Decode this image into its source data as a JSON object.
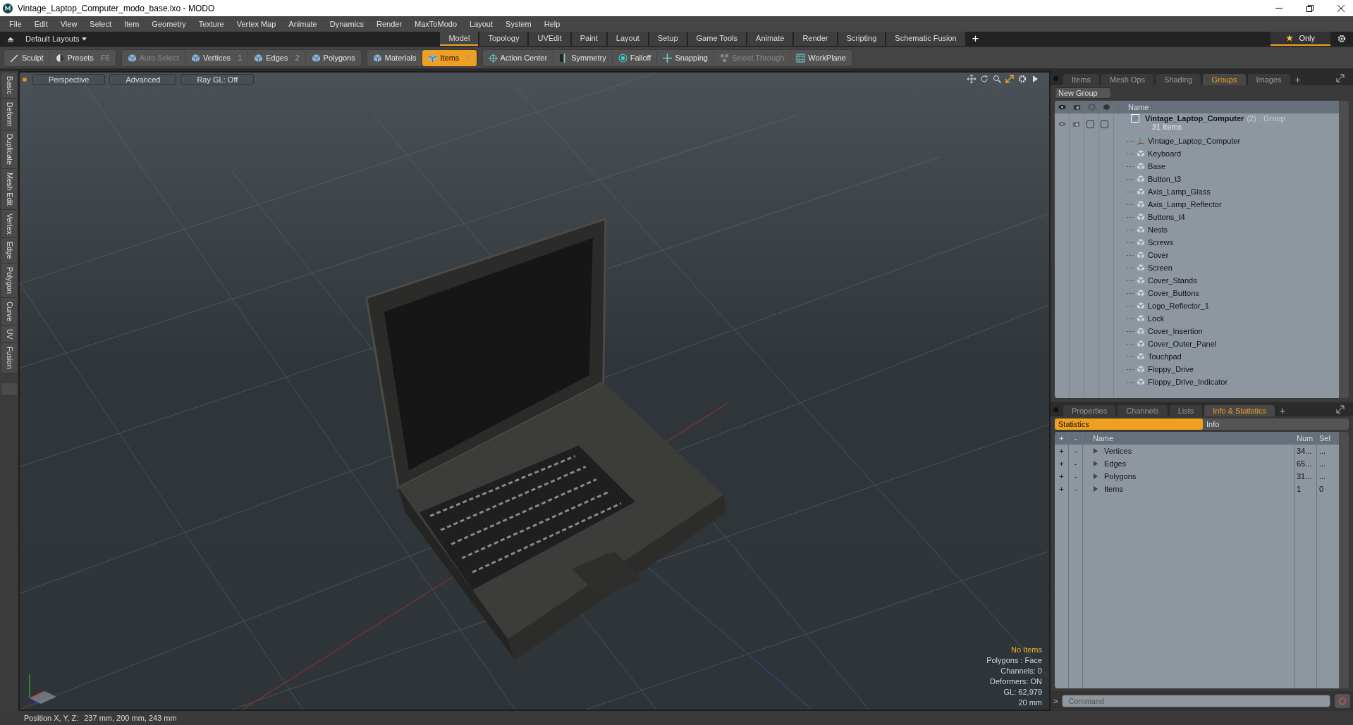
{
  "window": {
    "title": "Vintage_Laptop_Computer_modo_base.lxo - MODO"
  },
  "menu": [
    "File",
    "Edit",
    "View",
    "Select",
    "Item",
    "Geometry",
    "Texture",
    "Vertex Map",
    "Animate",
    "Dynamics",
    "Render",
    "MaxToModo",
    "Layout",
    "System",
    "Help"
  ],
  "layout_bar": {
    "layouts": "Default Layouts",
    "tabs": [
      {
        "label": "Model",
        "selected": true
      },
      {
        "label": "Topology",
        "selected": false
      },
      {
        "label": "UVEdit",
        "selected": false
      },
      {
        "label": "Paint",
        "selected": false
      },
      {
        "label": "Layout",
        "selected": false
      },
      {
        "label": "Setup",
        "selected": false
      },
      {
        "label": "Game Tools",
        "selected": false
      },
      {
        "label": "Animate",
        "selected": false
      },
      {
        "label": "Render",
        "selected": false
      },
      {
        "label": "Scripting",
        "selected": false
      },
      {
        "label": "Schematic Fusion",
        "selected": false
      }
    ],
    "add_tab": "+",
    "only": "Only"
  },
  "toolbar": [
    [
      {
        "kind": "sculpt",
        "label": "Sculpt",
        "disabled": false,
        "selected": false
      },
      {
        "kind": "presets",
        "label": "Presets",
        "shortcut": "F6",
        "disabled": false,
        "selected": false
      }
    ],
    [
      {
        "kind": "cube",
        "label": "Auto Select",
        "disabled": true,
        "selected": false
      },
      {
        "kind": "cube",
        "label": "Vertices",
        "shortcut": "1",
        "disabled": false,
        "selected": false
      },
      {
        "kind": "cube",
        "label": "Edges",
        "shortcut": "2",
        "disabled": false,
        "selected": false
      },
      {
        "kind": "cube",
        "label": "Polygons",
        "disabled": false,
        "selected": false
      }
    ],
    [
      {
        "kind": "cube",
        "label": "Materials",
        "disabled": false,
        "selected": false
      },
      {
        "kind": "cube",
        "label": "Items",
        "shortcut": "5",
        "disabled": false,
        "selected": true
      }
    ],
    [
      {
        "kind": "target",
        "label": "Action Center",
        "disabled": false,
        "selected": false
      },
      {
        "kind": "symmetry",
        "label": "Symmetry",
        "disabled": false,
        "selected": false
      },
      {
        "kind": "falloff",
        "label": "Falloff",
        "disabled": false,
        "selected": false
      },
      {
        "kind": "snap",
        "label": "Snapping",
        "disabled": false,
        "selected": false
      },
      {
        "kind": "through",
        "label": "Select Through",
        "disabled": true,
        "selected": false
      },
      {
        "kind": "workplane",
        "label": "WorkPlane",
        "disabled": false,
        "selected": false
      }
    ]
  ],
  "left_tabs": [
    "Basic",
    "Deform",
    "Duplicate",
    "Mesh Edit",
    "Vertex",
    "Edge",
    "Polygon",
    "Curve",
    "UV",
    "Fusion"
  ],
  "viewport": {
    "buttons": [
      "Perspective",
      "Advanced",
      "Ray GL: Off"
    ],
    "info": [
      {
        "text": "No Items",
        "kind": "highlight"
      },
      {
        "text": "Polygons : Face",
        "kind": "normal"
      },
      {
        "text": "Channels: 0",
        "kind": "normal"
      },
      {
        "text": "Deformers: ON",
        "kind": "normal"
      },
      {
        "text": "GL: 62,979",
        "kind": "normal"
      },
      {
        "text": "20 mm",
        "kind": "normal"
      }
    ]
  },
  "status_bar": {
    "label": "Position X, Y, Z:",
    "value": "237 mm, 200 mm, 243 mm"
  },
  "groups_panel": {
    "tabs": [
      {
        "label": "Items",
        "selected": false
      },
      {
        "label": "Mesh Ops",
        "selected": false
      },
      {
        "label": "Shading",
        "selected": false
      },
      {
        "label": "Groups",
        "selected": true
      },
      {
        "label": "Images",
        "selected": false
      }
    ],
    "add_tab": "+",
    "new_group": "New Group",
    "column": "Name",
    "group": {
      "name": "Vintage_Laptop_Computer",
      "count": "(2)",
      "type": ": Group",
      "items_count": "31 Items",
      "children": [
        {
          "name": "Vintage_Laptop_Computer",
          "kind": "locator"
        },
        {
          "name": "Keyboard",
          "kind": "mesh"
        },
        {
          "name": "Base",
          "kind": "mesh"
        },
        {
          "name": "Button_t3",
          "kind": "mesh"
        },
        {
          "name": "Axis_Lamp_Glass",
          "kind": "mesh"
        },
        {
          "name": "Axis_Lamp_Reflector",
          "kind": "mesh"
        },
        {
          "name": "Buttons_t4",
          "kind": "mesh"
        },
        {
          "name": "Nests",
          "kind": "mesh"
        },
        {
          "name": "Screws",
          "kind": "mesh"
        },
        {
          "name": "Cover",
          "kind": "mesh"
        },
        {
          "name": "Screen",
          "kind": "mesh"
        },
        {
          "name": "Cover_Stands",
          "kind": "mesh"
        },
        {
          "name": "Cover_Buttons",
          "kind": "mesh"
        },
        {
          "name": "Logo_Reflector_1",
          "kind": "mesh"
        },
        {
          "name": "Lock",
          "kind": "mesh"
        },
        {
          "name": "Cover_Insertion",
          "kind": "mesh"
        },
        {
          "name": "Cover_Outer_Panel",
          "kind": "mesh"
        },
        {
          "name": "Touchpad",
          "kind": "mesh"
        },
        {
          "name": "Floppy_Drive",
          "kind": "mesh"
        },
        {
          "name": "Floppy_Drive_Indicator",
          "kind": "mesh"
        }
      ]
    }
  },
  "stats_panel": {
    "tabs": [
      {
        "label": "Properties",
        "selected": false
      },
      {
        "label": "Channels",
        "selected": false
      },
      {
        "label": "Lists",
        "selected": false
      },
      {
        "label": "Info & Statistics",
        "selected": true
      }
    ],
    "add_tab": "+",
    "subtabs": [
      {
        "label": "Statistics",
        "selected": true
      },
      {
        "label": "Info",
        "selected": false
      }
    ],
    "header": {
      "add": "+",
      "remove": "-",
      "name": "Name",
      "num": "Num",
      "sel": "Sel"
    },
    "rows": [
      {
        "add": "+",
        "remove": "-",
        "name": "Vertices",
        "num": "34...",
        "sel": "..."
      },
      {
        "add": "+",
        "remove": "-",
        "name": "Edges",
        "num": "65...",
        "sel": "..."
      },
      {
        "add": "+",
        "remove": "-",
        "name": "Polygons",
        "num": "31...",
        "sel": "..."
      },
      {
        "add": "+",
        "remove": "-",
        "name": "Items",
        "num": "1",
        "sel": "0"
      }
    ],
    "prompt": ">",
    "command_placeholder": "Command"
  }
}
